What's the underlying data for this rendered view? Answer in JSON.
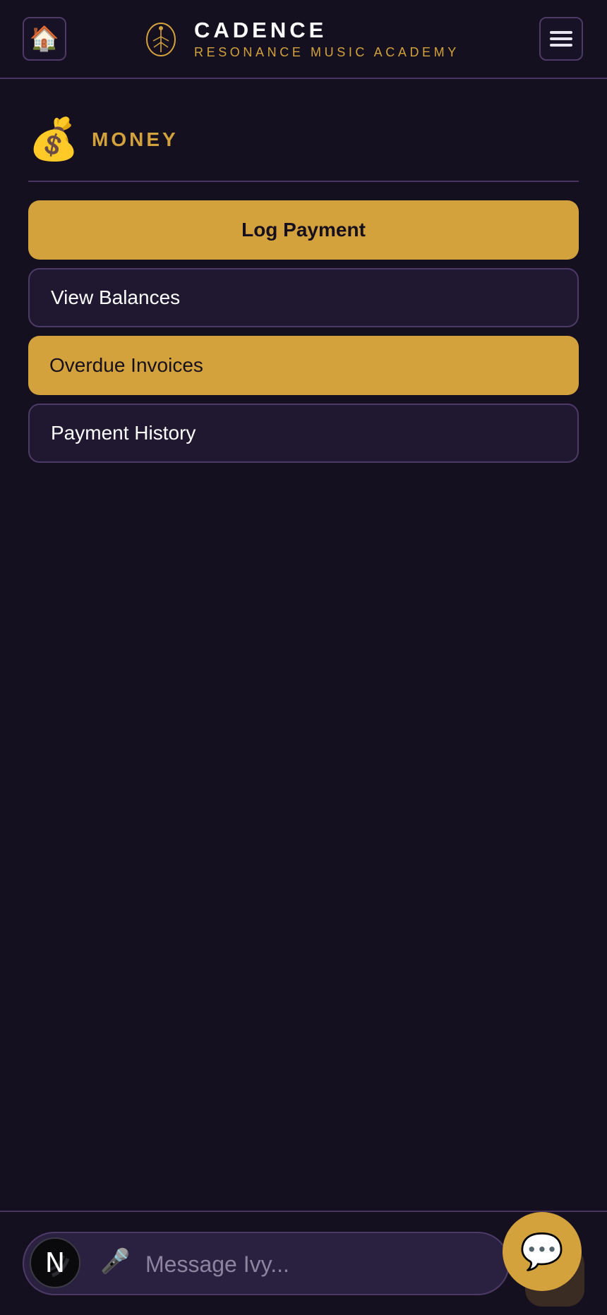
{
  "header": {
    "home_icon": "🏠",
    "brand_name": "CADENCE",
    "brand_subtitle": "RESONANCE MUSIC ACADEMY"
  },
  "section": {
    "emoji": "💰",
    "title": "MONEY"
  },
  "actions": [
    {
      "label": "Log Payment",
      "style": "primary"
    },
    {
      "label": "View Balances",
      "style": "outline"
    },
    {
      "label": "Overdue Invoices",
      "style": "primary"
    },
    {
      "label": "Payment History",
      "style": "outline"
    }
  ],
  "composer": {
    "avatar_letter": "N",
    "mic_icon": "🎤",
    "placeholder": "Message Ivy...",
    "chat_icon": "💬"
  },
  "colors": {
    "background": "#141020",
    "accent": "#d4a23c",
    "border": "#4e3a66",
    "card": "#1f1830"
  }
}
